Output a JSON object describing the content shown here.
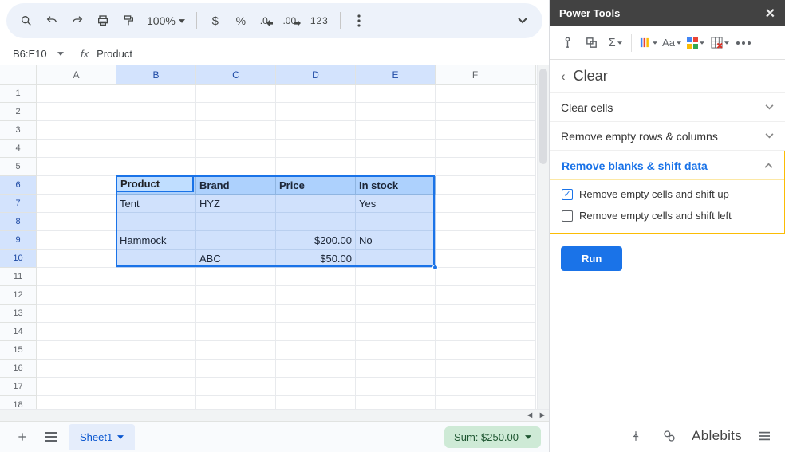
{
  "toolbar": {
    "zoom": "100%",
    "numberFormat123": "123"
  },
  "nameBox": "B6:E10",
  "formulaValue": "Product",
  "columns": [
    "A",
    "B",
    "C",
    "D",
    "E",
    "F"
  ],
  "selectedCols": [
    "B",
    "C",
    "D",
    "E"
  ],
  "rowCount": 19,
  "selectedRows": [
    6,
    7,
    8,
    9,
    10
  ],
  "activeCell": {
    "col": "B",
    "row": 6
  },
  "table": {
    "startCol": "B",
    "startRow": 6,
    "headers": [
      "Product",
      "Brand",
      "Price",
      "In stock"
    ],
    "rows": [
      {
        "Product": "Tent",
        "Brand": "HYZ",
        "Price": "",
        "In stock": "Yes"
      },
      {
        "Product": "",
        "Brand": "",
        "Price": "",
        "In stock": ""
      },
      {
        "Product": "Hammock",
        "Brand": "",
        "Price": "$200.00",
        "In stock": "No"
      },
      {
        "Product": "",
        "Brand": "ABC",
        "Price": "$50.00",
        "In stock": ""
      }
    ]
  },
  "sheetTabs": {
    "active": "Sheet1"
  },
  "statusSummary": "Sum: $250.00",
  "sidebar": {
    "title": "Power Tools",
    "heading": "Clear",
    "sections": {
      "clearCells": "Clear cells",
      "removeEmpty": "Remove empty rows & columns",
      "removeBlanks": "Remove blanks & shift data"
    },
    "options": {
      "shiftUp": "Remove empty cells and shift up",
      "shiftLeft": "Remove empty cells and shift left"
    },
    "runLabel": "Run",
    "brand": "Ablebits"
  },
  "chart_data": null
}
